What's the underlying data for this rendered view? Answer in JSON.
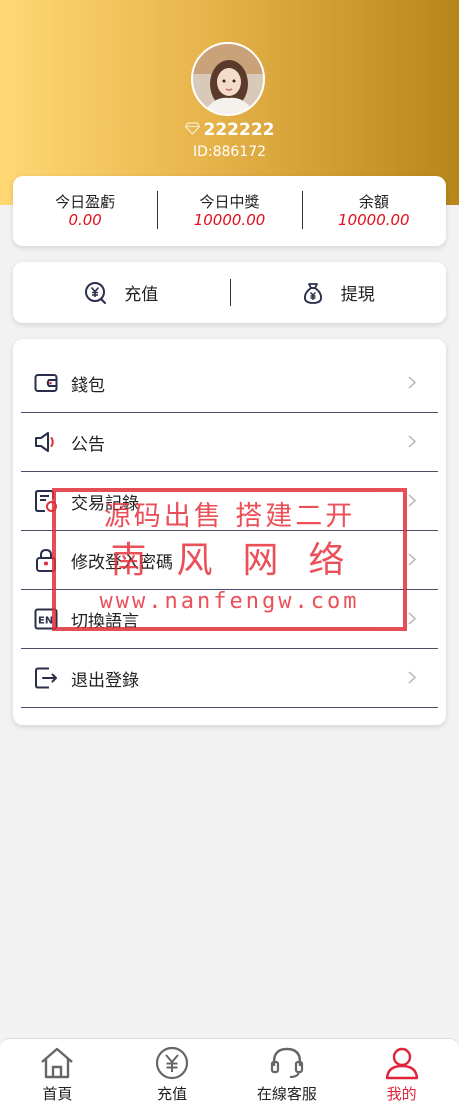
{
  "profile": {
    "username": "222222",
    "user_id": "ID:886172",
    "avatar_icon": "user-avatar-photo",
    "level_icon": "diamond-icon"
  },
  "stats": [
    {
      "label": "今日盈虧",
      "value": "0.00"
    },
    {
      "label": "今日中獎",
      "value": "10000.00"
    },
    {
      "label": "余額",
      "value": "10000.00"
    }
  ],
  "actions": {
    "recharge": {
      "label": "充值",
      "icon": "yen-coin-icon"
    },
    "withdraw": {
      "label": "提現",
      "icon": "money-bag-icon"
    }
  },
  "menu": [
    {
      "label": "錢包",
      "icon": "wallet-icon"
    },
    {
      "label": "公告",
      "icon": "megaphone-icon"
    },
    {
      "label": "交易記錄",
      "icon": "transaction-record-icon"
    },
    {
      "label": "修改登入密碼",
      "icon": "lock-icon"
    },
    {
      "label": "切換語言",
      "icon": "language-en-icon"
    },
    {
      "label": "退出登錄",
      "icon": "logout-icon"
    }
  ],
  "watermark": {
    "line1": "源码出售 搭建二开",
    "line2": "南风网络",
    "line3": "www.nanfengw.com"
  },
  "tabbar": [
    {
      "label": "首頁",
      "icon": "home-icon"
    },
    {
      "label": "充值",
      "icon": "yen-coin-icon"
    },
    {
      "label": "在線客服",
      "icon": "headset-icon"
    },
    {
      "label": "我的",
      "icon": "user-icon",
      "active": true
    }
  ],
  "colors": {
    "accent_gold": "#d9a43a",
    "value_red": "#e0101c",
    "active_tab": "#e0253a",
    "icon_navy": "#2a2e4a"
  }
}
